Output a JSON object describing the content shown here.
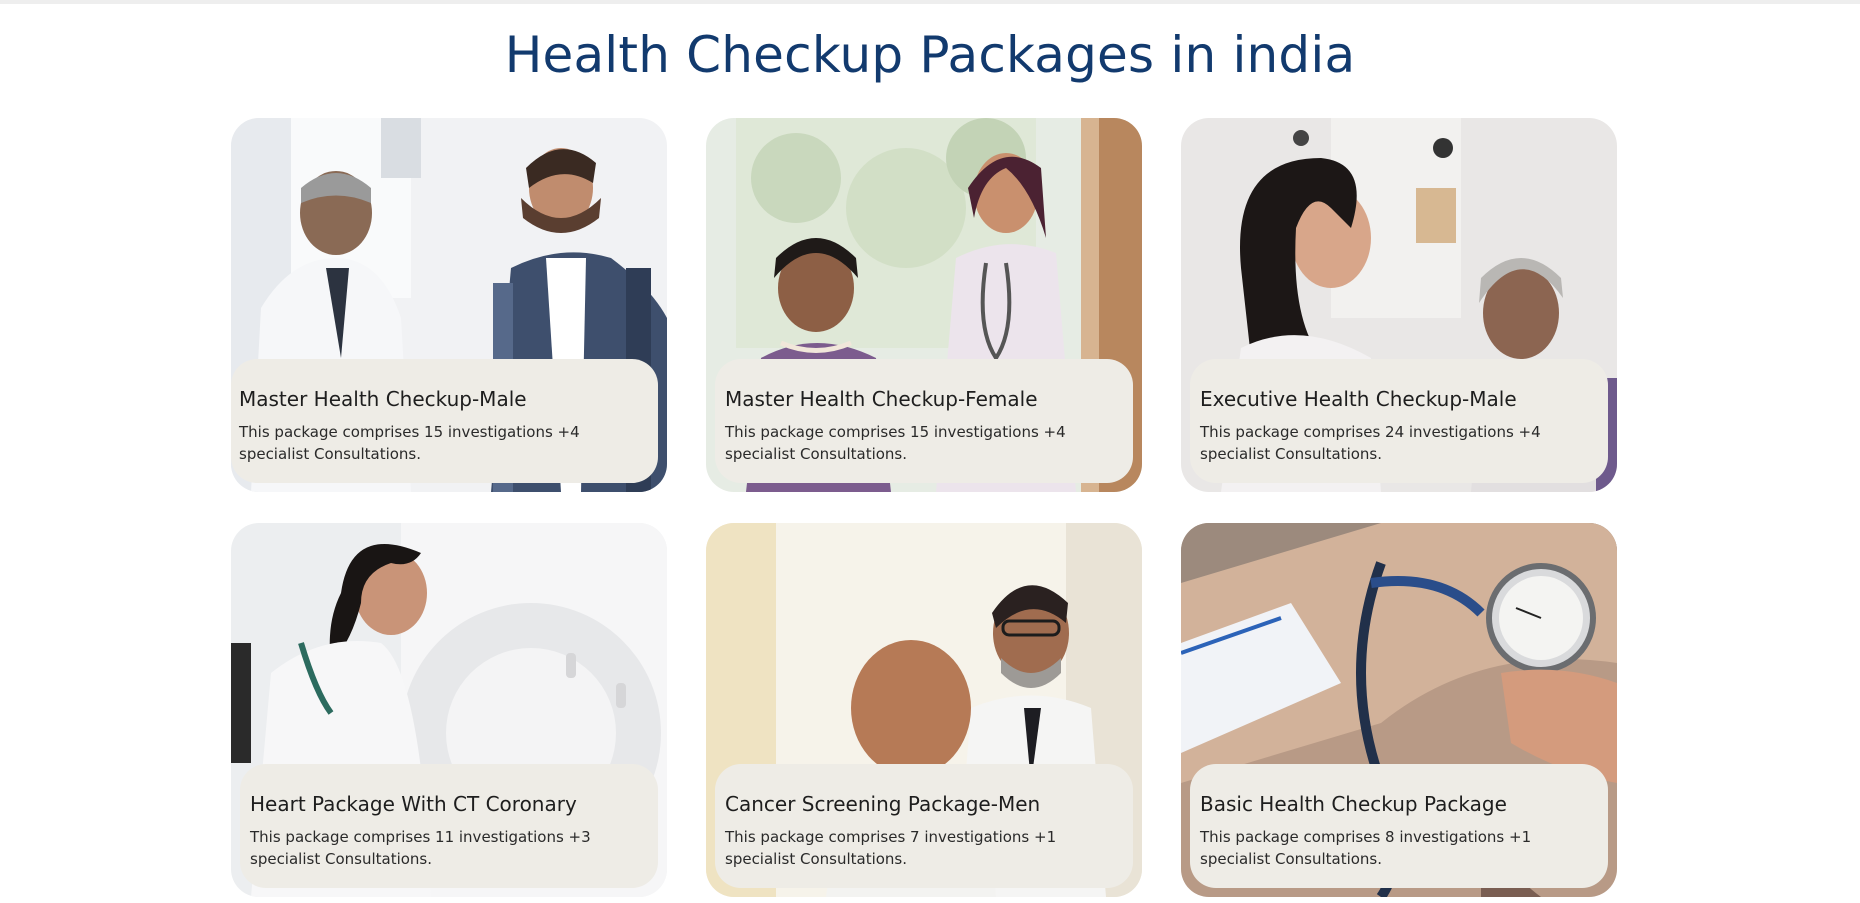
{
  "page": {
    "title": "Health Checkup Packages in india"
  },
  "packages": [
    {
      "title": "Master Health Checkup-Male",
      "description": "This package comprises 15 investigations +4 specialist Consultations.",
      "image": "doctor-with-male-patient-photo"
    },
    {
      "title": "Master Health Checkup-Female",
      "description": "This package comprises 15 investigations +4 specialist Consultations.",
      "image": "doctor-with-female-patient-photo"
    },
    {
      "title": "Executive Health Checkup-Male",
      "description": "This package comprises 24 investigations +4 specialist Consultations.",
      "image": "doctor-with-elderly-patient-photo"
    },
    {
      "title": "Heart Package With CT Coronary",
      "description": "This package comprises 11 investigations +3 specialist Consultations.",
      "image": "ct-scanner-technician-photo"
    },
    {
      "title": "Cancer Screening Package-Men",
      "description": "This package comprises 7 investigations +1 specialist Consultations.",
      "image": "doctor-with-smiling-patient-photo"
    },
    {
      "title": "Basic Health Checkup Package",
      "description": "This package comprises 8 investigations +1 specialist Consultations.",
      "image": "blood-pressure-gauge-photo"
    }
  ],
  "colors": {
    "title": "#123a6e",
    "card_overlay": "#eeece6",
    "card_text": "#1e1e1e"
  }
}
